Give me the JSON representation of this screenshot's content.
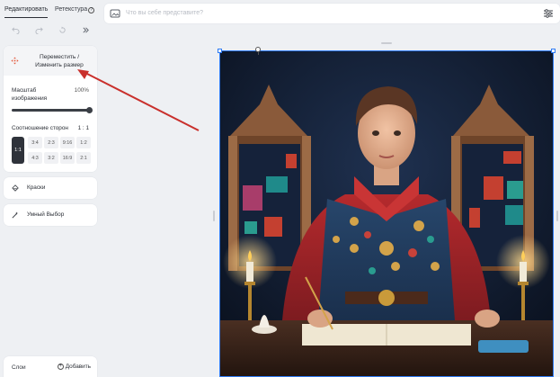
{
  "tabs": [
    {
      "label": "Редактировать",
      "active": true
    },
    {
      "label": "Ретекстура",
      "active": false,
      "help_icon": "question-icon"
    }
  ],
  "history": {
    "undo_icon": "undo-icon",
    "redo_icon": "redo-icon",
    "reset_icon": "reset-icon",
    "skip_icon": "skip-icon"
  },
  "move_tool": {
    "label_line1": "Переместить /",
    "label_line2": "Изменить размер",
    "icon": "move-arrows-icon",
    "icon_color": "#e3583a"
  },
  "scale": {
    "label_line1": "Масштаб",
    "label_line2": "изображения",
    "value": "100%",
    "level": 1.0
  },
  "aspect_ratio": {
    "label": "Соотношение сторон",
    "value": "1 : 1",
    "selected": "1:1",
    "options_row1": [
      "3:4",
      "2:3",
      "9:16",
      "1:2"
    ],
    "options_row2": [
      "4:3",
      "3:2",
      "16:9",
      "2:1"
    ]
  },
  "paints": {
    "label": "Краски",
    "icon": "paint-bucket-icon"
  },
  "smart_select": {
    "label": "Умный Выбор",
    "icon": "magic-wand-icon"
  },
  "layers": {
    "label": "Слои",
    "add_label": "Добавить"
  },
  "prompt": {
    "placeholder": "Что вы себе представите?",
    "icon": "image-prompt-icon",
    "settings_icon": "sliders-icon"
  },
  "accent_color": "#2e7bf3",
  "arrow_color": "#c9302c"
}
